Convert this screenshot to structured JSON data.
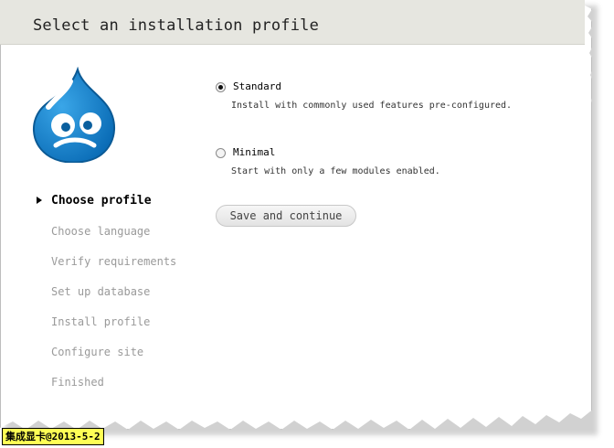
{
  "header": {
    "title": "Select an installation profile"
  },
  "logo": {
    "name": "drupal-logo",
    "color": "#0077c0"
  },
  "steps": [
    {
      "label": "Choose profile",
      "active": true
    },
    {
      "label": "Choose language",
      "active": false
    },
    {
      "label": "Verify requirements",
      "active": false
    },
    {
      "label": "Set up database",
      "active": false
    },
    {
      "label": "Install profile",
      "active": false
    },
    {
      "label": "Configure site",
      "active": false
    },
    {
      "label": "Finished",
      "active": false
    }
  ],
  "profiles": [
    {
      "label": "Standard",
      "description": "Install with commonly used features pre-configured.",
      "selected": true
    },
    {
      "label": "Minimal",
      "description": "Start with only a few modules enabled.",
      "selected": false
    }
  ],
  "actions": {
    "save_label": "Save and continue"
  },
  "watermark": {
    "text": "集成显卡@2013-5-2"
  }
}
